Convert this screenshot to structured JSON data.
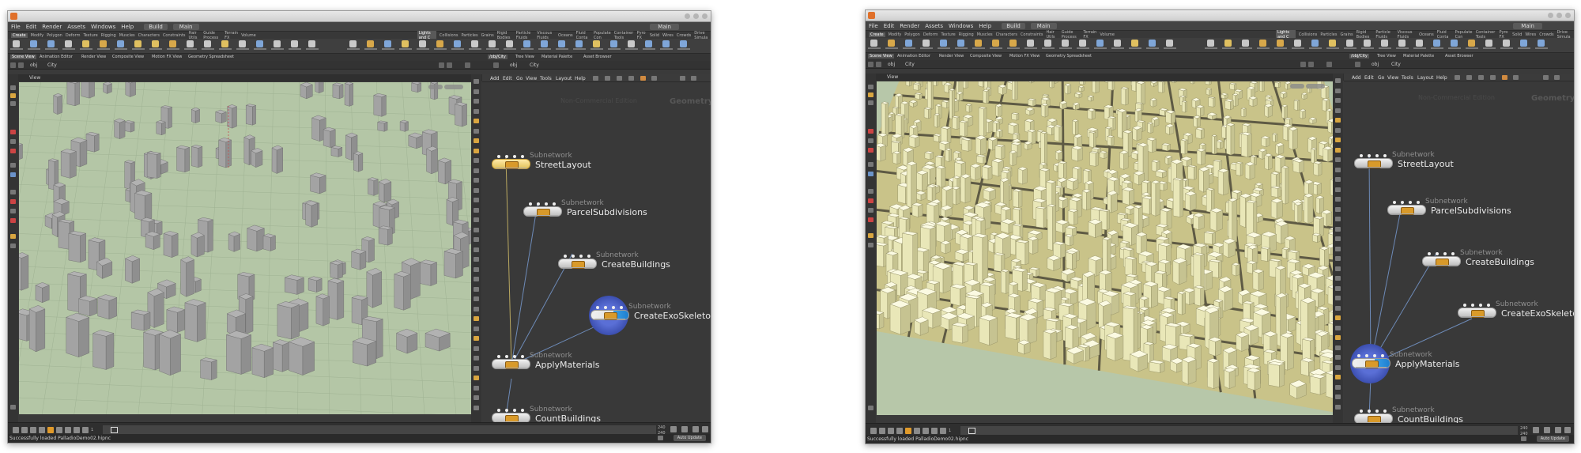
{
  "window_left": {
    "title": "",
    "menu": [
      "File",
      "Edit",
      "Render",
      "Assets",
      "Windows",
      "Help"
    ],
    "desktop": "Build",
    "main_label": "Main",
    "shelf_tabs": [
      "Create",
      "Modify",
      "Polygon",
      "Deform",
      "Texture",
      "Rigging",
      "Muscles",
      "Characters",
      "Constraints",
      "Hair Utils",
      "Guide Process",
      "Terrain FX",
      "Volume"
    ],
    "shelf_tabs_right": [
      "Lights and C",
      "Collisions",
      "Particles",
      "Grains",
      "Rigid Bodies",
      "Particle Fluids",
      "Viscous Fluids",
      "Oceans",
      "Fluid Conta",
      "Populate Con",
      "Container Tools",
      "Pyro FX",
      "Solid",
      "Wires",
      "Crowds",
      "Drive Simula"
    ],
    "pane_tabs_left": [
      "Scene View",
      "Animation Editor",
      "Render View",
      "Composite View",
      "Motion FX View",
      "Geometry Spreadsheet"
    ],
    "pane_tabs_right": [
      "/obj/City",
      "Tree View",
      "Material Palette",
      "Asset Browser"
    ],
    "path_obj": "obj",
    "path_node": "City",
    "viewport_title": "View",
    "net_menu": [
      "Add",
      "Edit",
      "Go",
      "View",
      "Tools",
      "Layout",
      "Help"
    ],
    "net_context": "Non-Commercial Edition",
    "net_type": "Geometry",
    "nodes": [
      {
        "kind": "Subnetwork",
        "name": "StreetLayout"
      },
      {
        "kind": "Subnetwork",
        "name": "ParcelSubdivisions"
      },
      {
        "kind": "Subnetwork",
        "name": "CreateBuildings"
      },
      {
        "kind": "Subnetwork",
        "name": "CreateExoSkeleton"
      },
      {
        "kind": "Subnetwork",
        "name": "ApplyMaterials"
      },
      {
        "kind": "Subnetwork",
        "name": "CountBuildings"
      }
    ],
    "frame_current": "1",
    "frame_start": "1",
    "frame_end": "240",
    "frame_end2": "240",
    "status_message": "Successfully loaded PalladioDemo02.hipnc",
    "auto_update": "Auto Update"
  },
  "window_right": {
    "title": "",
    "menu": [
      "File",
      "Edit",
      "Render",
      "Assets",
      "Windows",
      "Help"
    ],
    "desktop": "Build",
    "main_label": "Main",
    "pane_tabs_left": [
      "Scene View",
      "Animation Editor",
      "Render View",
      "Composite View",
      "Motion FX View",
      "Geometry Spreadsheet"
    ],
    "pane_tabs_right": [
      "/obj/City",
      "Tree View",
      "Material Palette",
      "Asset Browser"
    ],
    "path_obj": "obj",
    "path_node": "City",
    "viewport_title": "View",
    "net_menu": [
      "Add",
      "Edit",
      "Go",
      "View",
      "Tools",
      "Layout",
      "Help"
    ],
    "net_context": "Non-Commercial Edition",
    "net_type": "Geometry",
    "nodes": [
      {
        "kind": "Subnetwork",
        "name": "StreetLayout"
      },
      {
        "kind": "Subnetwork",
        "name": "ParcelSubdivisions"
      },
      {
        "kind": "Subnetwork",
        "name": "CreateBuildings"
      },
      {
        "kind": "Subnetwork",
        "name": "CreateExoSkeleton"
      },
      {
        "kind": "Subnetwork",
        "name": "ApplyMaterials"
      },
      {
        "kind": "Subnetwork",
        "name": "CountBuildings"
      }
    ],
    "frame_current": "1",
    "frame_start": "1",
    "frame_end": "240",
    "frame_end2": "240",
    "status_message": "Successfully loaded PalladioDemo02.hipnc",
    "auto_update": "Auto Update"
  },
  "colors": {
    "viewport_bg": "#b4c6a6",
    "building_wire": "#8b8b8b",
    "building_solid": "#f1f0c4",
    "node_selected": "#ffe9a6",
    "display_flag": "#3aa0e8",
    "template_halo": "#5a6fd6"
  }
}
